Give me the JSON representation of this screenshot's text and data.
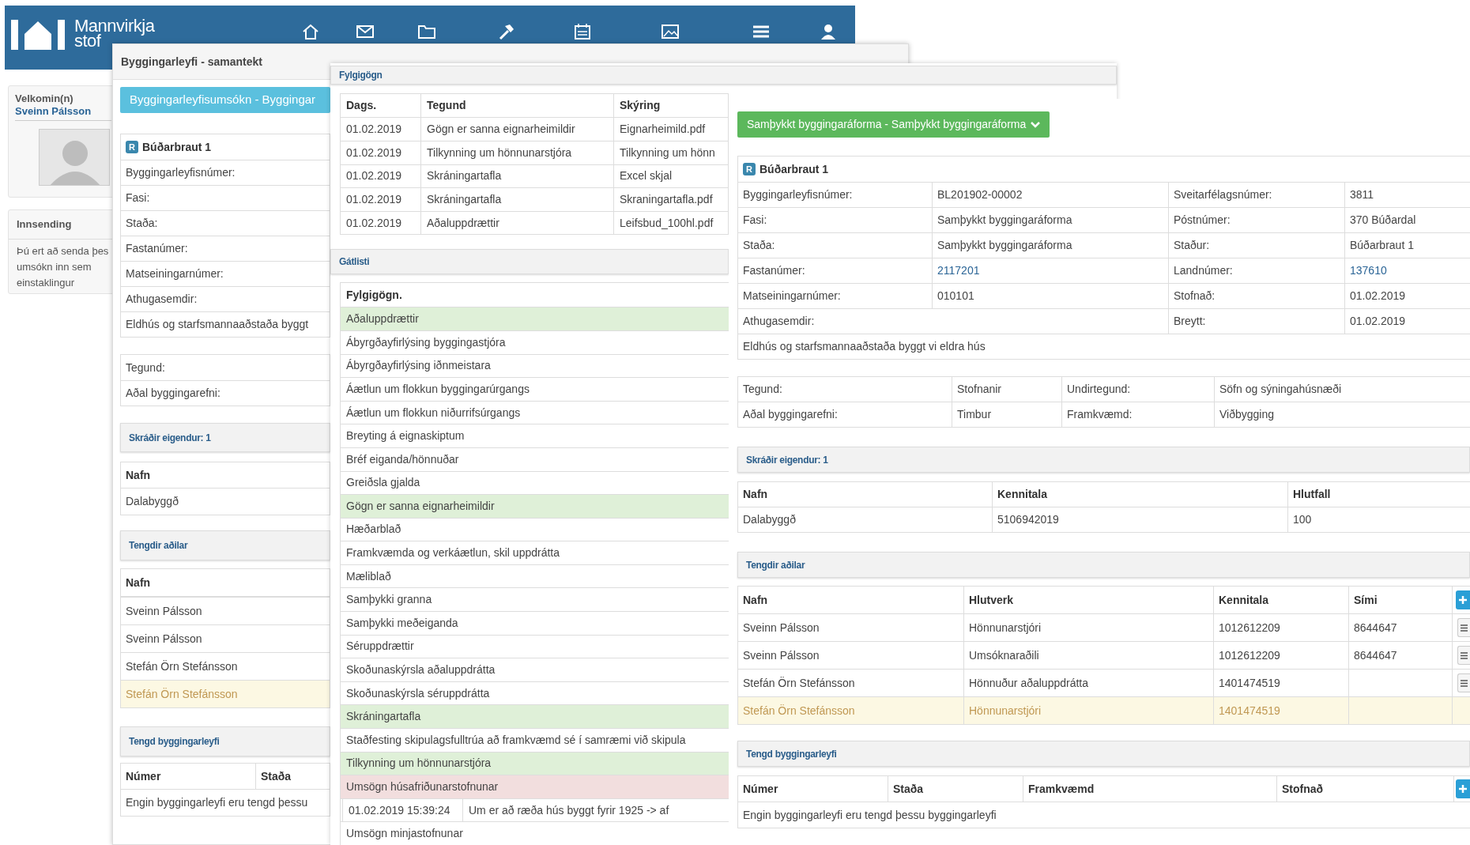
{
  "app_header": {
    "logo_lines": [
      "Mannvirkja",
      "stof"
    ]
  },
  "sidebar": {
    "welcome_label": "Velkomin(n)",
    "user_name": "Sveinn Pálsson",
    "submission_title": "Innsending",
    "submission_lines": [
      "Þú ert að senda þes",
      "umsókn inn sem",
      "einstaklingur"
    ]
  },
  "summary_panel": {
    "title": "Byggingarleyfi - samantekt",
    "status_button": "Byggingarleyfisumsókn - Byggingar",
    "property": {
      "badge": "R",
      "name": "Búðarbraut 1",
      "fields": [
        "Byggingarleyfisnúmer:",
        "Fasi:",
        "Staða:",
        "Fastanúmer:",
        "Matseiningarnúmer:",
        "Athugasemdir:"
      ],
      "note": "Eldhús og starfsmannaaðstaða byggt"
    },
    "type_fields": [
      "Tegund:",
      "Aðal byggingarefni:"
    ],
    "owners": {
      "title": "Skráðir eigendur: 1",
      "columns": [
        "Nafn"
      ],
      "rows": [
        {
          "cells": [
            "Dalabyggð"
          ],
          "highlighted": false
        }
      ]
    },
    "parties": {
      "title": "Tengdir aðilar",
      "columns": [
        "Nafn"
      ],
      "rows": [
        {
          "cells": [
            "Sveinn Pálsson"
          ],
          "highlighted": false
        },
        {
          "cells": [
            "Sveinn Pálsson"
          ],
          "highlighted": false
        },
        {
          "cells": [
            "Stefán Örn Stefánsson"
          ],
          "highlighted": false
        },
        {
          "cells": [
            "Stefán Örn Stefánsson"
          ],
          "highlighted": true
        }
      ]
    },
    "related": {
      "title": "Tengd byggingarleyfi",
      "columns": [
        "Númer",
        "Staða"
      ],
      "empty_text": "Engin byggingarleyfi eru tengd þessu"
    }
  },
  "documents_panel": {
    "title": "Fylgigögn",
    "columns": [
      "Dags.",
      "Tegund",
      "Skýring"
    ],
    "rows": [
      [
        "01.02.2019",
        "Gögn er sanna eignarheimildir",
        "Eignarheimild.pdf"
      ],
      [
        "01.02.2019",
        "Tilkynning um hönnunarstjóra",
        "Tilkynning um hönn"
      ],
      [
        "01.02.2019",
        "Skráningartafla",
        "Excel skjal"
      ],
      [
        "01.02.2019",
        "Skráningartafla",
        "Skraningartafla.pdf"
      ],
      [
        "01.02.2019",
        "Aðaluppdrættir",
        "Leifsbud_100hl.pdf"
      ]
    ],
    "checklist_title": "Gátlisti",
    "checklist_heading": "Fylgigögn.",
    "items": [
      {
        "label": "Aðaluppdrættir",
        "approved": true,
        "rejected": false
      },
      {
        "label": "Ábyrgðayfirlýsing byggingastjóra",
        "approved": false,
        "rejected": false
      },
      {
        "label": "Ábyrgðayfirlýsing iðnmeistara",
        "approved": false,
        "rejected": false
      },
      {
        "label": "Áætlun um flokkun byggingarúrgangs",
        "approved": false,
        "rejected": false
      },
      {
        "label": "Áætlun um flokkun niðurrifsúrgangs",
        "approved": false,
        "rejected": false
      },
      {
        "label": "Breyting á eignaskiptum",
        "approved": false,
        "rejected": false
      },
      {
        "label": "Bréf eiganda/hönnuðar",
        "approved": false,
        "rejected": false
      },
      {
        "label": "Greiðsla gjalda",
        "approved": false,
        "rejected": false
      },
      {
        "label": "Gögn er sanna eignarheimildir",
        "approved": true,
        "rejected": false
      },
      {
        "label": "Hæðarblað",
        "approved": false,
        "rejected": false
      },
      {
        "label": "Framkvæmda og verkáætlun, skil uppdrátta",
        "approved": false,
        "rejected": false
      },
      {
        "label": "Mæliblað",
        "approved": false,
        "rejected": false
      },
      {
        "label": "Samþykki granna",
        "approved": false,
        "rejected": false
      },
      {
        "label": "Samþykki meðeiganda",
        "approved": false,
        "rejected": false
      },
      {
        "label": "Séruppdrættir",
        "approved": false,
        "rejected": false
      },
      {
        "label": "Skoðunaskýrsla aðaluppdrátta",
        "approved": false,
        "rejected": false
      },
      {
        "label": "Skoðunaskýrsla séruppdrátta",
        "approved": false,
        "rejected": false
      },
      {
        "label": "Skráningartafla",
        "approved": true,
        "rejected": false
      },
      {
        "label": "Staðfesting skipulagsfulltrúa að framkvæmd sé í samræmi við skipula",
        "approved": false,
        "rejected": false
      },
      {
        "label": "Tilkynning um hönnunarstjóra",
        "approved": true,
        "rejected": false
      },
      {
        "label": "Umsögn húsafriðunarstofnunar",
        "approved": false,
        "rejected": true,
        "comments": [
          {
            "time": "01.02.2019 15:39:24",
            "text": "Um er að ræða hús byggt fyrir 1925 -> af"
          }
        ]
      },
      {
        "label": "Umsögn minjastofnunar",
        "approved": false,
        "rejected": false
      }
    ]
  },
  "detail_panel": {
    "status_button": "Samþykkt byggingaráforma - Samþykkt byggingaráforma",
    "property": {
      "badge": "R",
      "name": "Búðarbraut 1",
      "rows": [
        {
          "cells": [
            {
              "text": "Byggingarleyfisnúmer:",
              "kind": "label"
            },
            {
              "text": "BL201902-00002",
              "kind": "value"
            },
            {
              "text": "Sveitarfélagsnúmer:",
              "kind": "label"
            },
            {
              "text": "3811",
              "kind": "value"
            }
          ]
        },
        {
          "cells": [
            {
              "text": "Fasi:",
              "kind": "label"
            },
            {
              "text": "Samþykkt byggingaráforma",
              "kind": "value"
            },
            {
              "text": "Póstnúmer:",
              "kind": "label"
            },
            {
              "text": "370   Búðardal",
              "kind": "value"
            }
          ]
        },
        {
          "cells": [
            {
              "text": "Staða:",
              "kind": "label"
            },
            {
              "text": "Samþykkt byggingaráforma",
              "kind": "value"
            },
            {
              "text": "Staður:",
              "kind": "label"
            },
            {
              "text": "Búðarbraut 1",
              "kind": "value"
            }
          ]
        },
        {
          "cells": [
            {
              "text": "Fastanúmer:",
              "kind": "label"
            },
            {
              "text": "2117201",
              "kind": "link"
            },
            {
              "text": "Landnúmer:",
              "kind": "label"
            },
            {
              "text": "137610",
              "kind": "link"
            }
          ]
        },
        {
          "cells": [
            {
              "text": "Matseiningarnúmer:",
              "kind": "label"
            },
            {
              "text": "010101",
              "kind": "value"
            },
            {
              "text": "Stofnað:",
              "kind": "label"
            },
            {
              "text": "01.02.2019",
              "kind": "value"
            }
          ]
        },
        {
          "cells": [
            {
              "text": "Athugasemdir:",
              "kind": "label"
            },
            {
              "text": "",
              "kind": "value"
            },
            {
              "text": "Breytt:",
              "kind": "label"
            },
            {
              "text": "01.02.2019",
              "kind": "value"
            }
          ]
        },
        {
          "cells": [
            {
              "text": "Eldhús og starfsmannaaðstaða byggt vi eldra hús",
              "kind": "value"
            }
          ]
        }
      ]
    },
    "type_rows": [
      [
        "Tegund:",
        "Stofnanir",
        "Undirtegund:",
        "Söfn og sýningahúsnæði"
      ],
      [
        "Aðal byggingarefni:",
        "Timbur",
        "Framkvæmd:",
        "Viðbygging"
      ]
    ],
    "owners": {
      "title": "Skráðir eigendur: 1",
      "columns": [
        "Nafn",
        "Kennitala",
        "Hlutfall"
      ],
      "rows": [
        {
          "cells": [
            "Dalabyggð",
            "5106942019",
            "100"
          ],
          "highlighted": false
        }
      ]
    },
    "parties": {
      "title": "Tengdir aðilar",
      "columns": [
        "Nafn",
        "Hlutverk",
        "Kennitala",
        "Sími"
      ],
      "rows": [
        {
          "cells": [
            "Sveinn Pálsson",
            "Hönnunarstjóri",
            "1012612209",
            "8644647"
          ],
          "highlighted": false,
          "menu_button": true
        },
        {
          "cells": [
            "Sveinn Pálsson",
            "Umsóknaraðili",
            "1012612209",
            "8644647"
          ],
          "highlighted": false,
          "menu_button": true
        },
        {
          "cells": [
            "Stefán Örn Stefánsson",
            "Hönnuður aðaluppdrátta",
            "1401474519",
            ""
          ],
          "highlighted": false,
          "menu_button": true
        },
        {
          "cells": [
            "Stefán Örn Stefánsson",
            "Hönnunarstjóri",
            "1401474519",
            ""
          ],
          "highlighted": true,
          "menu_button": false
        }
      ]
    },
    "related": {
      "title": "Tengd byggingarleyfi",
      "columns": [
        "Númer",
        "Staða",
        "Framkvæmd",
        "Stofnað"
      ],
      "empty_text": "Engin byggingarleyfi eru tengd þessu byggingarleyfi"
    }
  }
}
